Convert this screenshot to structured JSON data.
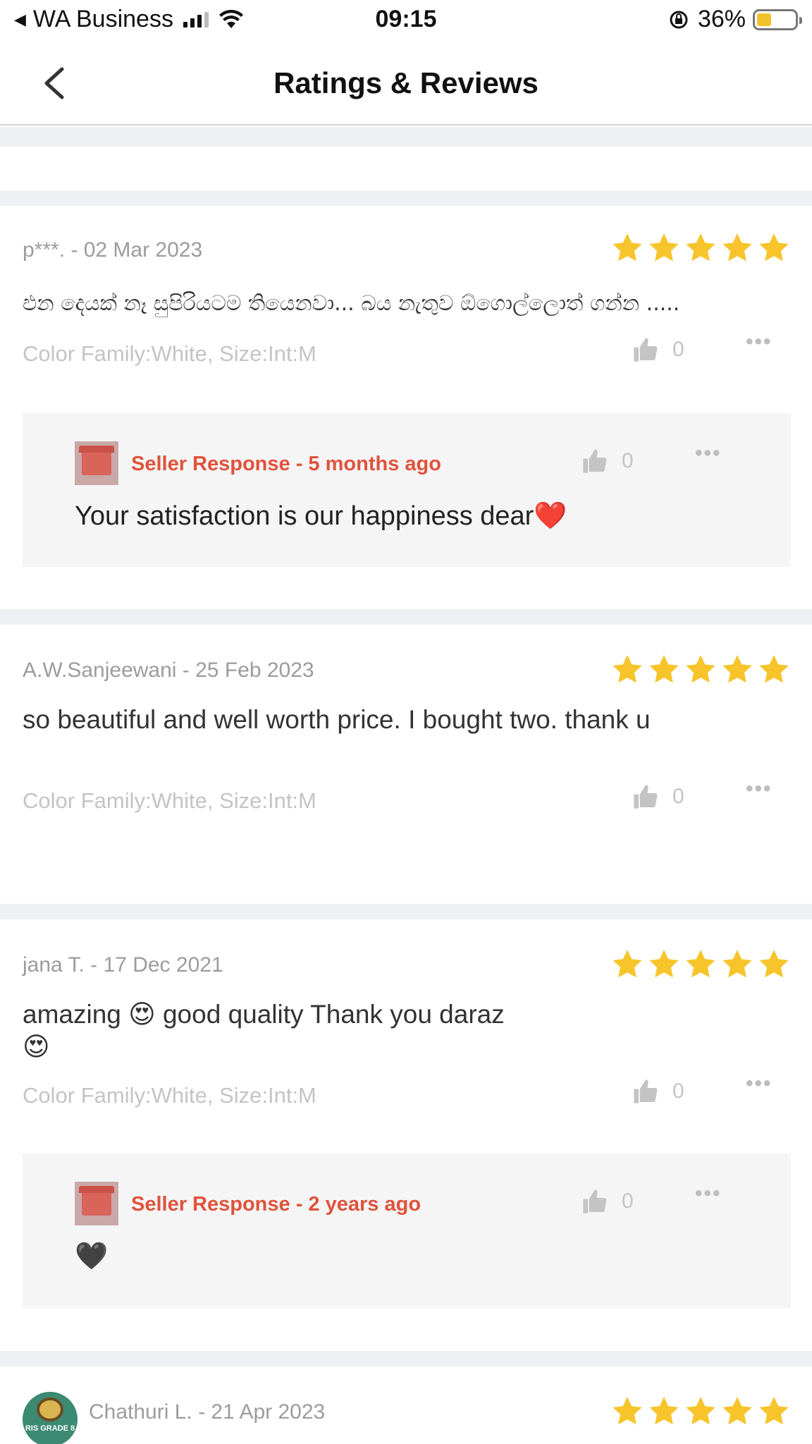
{
  "status_bar": {
    "carrier": "WA Business",
    "time": "09:15",
    "battery": "36%"
  },
  "header": {
    "title": "Ratings & Reviews"
  },
  "colors": {
    "star": "#f7c52b",
    "seller_accent": "#e1523b",
    "muted": "#9c9c9c"
  },
  "reviews": [
    {
      "meta": "p***. - 02 Mar 2023",
      "rating": 5,
      "body": "එන දෙයක් නෑ සුපිරියටම තියෙනවා... බය නැතුව ඕගොල්ලොත් ගන්න .....",
      "sku": "Color Family:White, Size:Int:M",
      "likes": "0",
      "seller_response": {
        "label": "Seller Response - 5  months ago",
        "likes": "0",
        "text": "Your satisfaction is our happiness dear❤️"
      }
    },
    {
      "meta": "A.W.Sanjeewani - 25 Feb 2023",
      "rating": 5,
      "body": "so beautiful and well worth price. I bought two. thank u",
      "sku": "Color Family:White, Size:Int:M",
      "likes": "0"
    },
    {
      "meta": "jana T. - 17 Dec 2021",
      "rating": 5,
      "body_line1": "amazing 😍 good quality Thank you  daraz",
      "body_line2": "😍",
      "sku": "Color Family:White, Size:Int:M",
      "likes": "0",
      "seller_response": {
        "label": "Seller Response - 2  years ago",
        "likes": "0",
        "text": "🖤"
      }
    },
    {
      "meta": "Chathuri L. - 21 Apr 2023",
      "rating": 5,
      "avatar_text": "RIS GRADE 8"
    }
  ]
}
